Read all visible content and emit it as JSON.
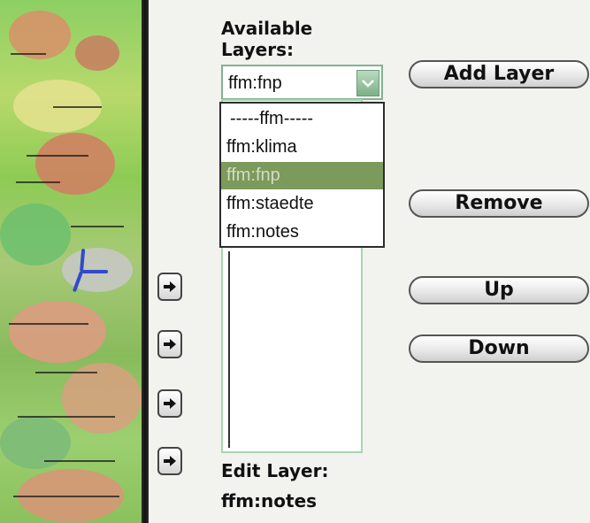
{
  "available_layers_label": "Available\nLayers:",
  "select": {
    "value": "ffm:fnp",
    "arrow_icon": "chevron-down-icon"
  },
  "dropdown": {
    "options": [
      "-----ffm-----",
      "ffm:klima",
      "ffm:fnp",
      "ffm:staedte",
      "ffm:notes"
    ],
    "selected_index": 2
  },
  "buttons": {
    "add_layer": "Add Layer",
    "remove": "Remove",
    "up": "Up",
    "down": "Down"
  },
  "arrow_buttons": {
    "icon": "arrow-right-icon",
    "count": 4
  },
  "edit_layer": {
    "label": "Edit Layer:",
    "value": "ffm:notes"
  },
  "colors": {
    "select_border": "#84b28f",
    "selected_option_bg": "#7b9a5c",
    "map_green": "#8ccf63",
    "river_blue": "#2f4bc8"
  }
}
